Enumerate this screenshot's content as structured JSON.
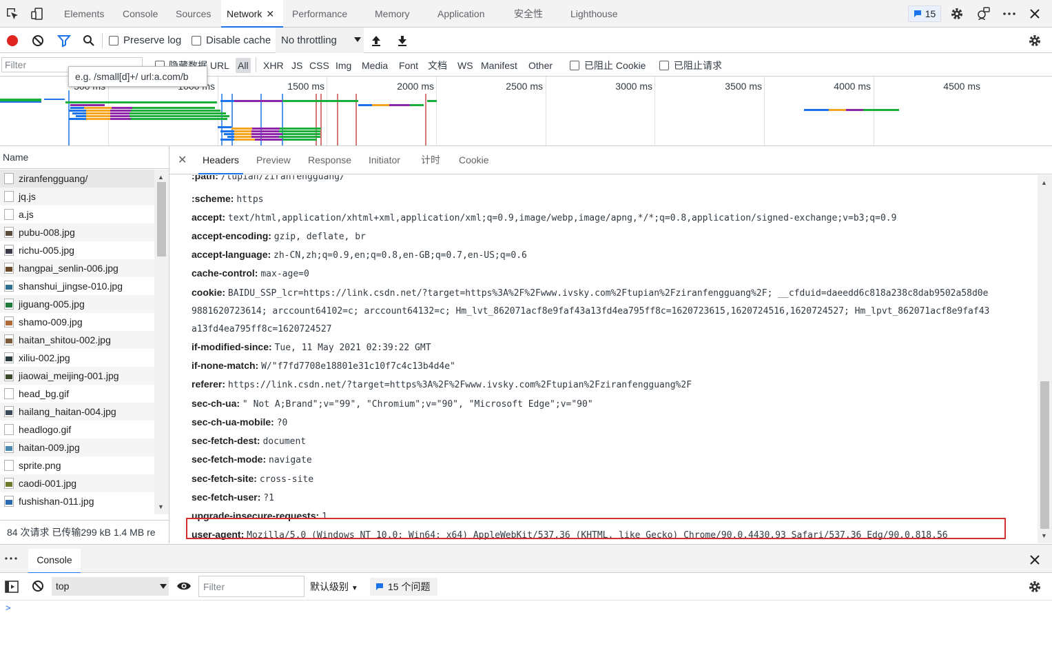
{
  "tabbar": {
    "tabs": [
      "Elements",
      "Console",
      "Sources",
      "Network",
      "Performance",
      "Memory",
      "Application",
      "安全性",
      "Lighthouse"
    ],
    "active": "Network",
    "issues_count": "15"
  },
  "toolbar": {
    "preserve_log": "Preserve log",
    "disable_cache": "Disable cache",
    "throttling": "No throttling"
  },
  "filter": {
    "placeholder": "Filter",
    "hide_data_urls": "隐藏数据 URL",
    "types": [
      "All",
      "XHR",
      "JS",
      "CSS",
      "Img",
      "Media",
      "Font",
      "文档",
      "WS",
      "Manifest",
      "Other"
    ],
    "blocked_cookies": "已阻止 Cookie",
    "blocked_requests": "已阻止请求",
    "tooltip": "e.g. /small[d]+/ url:a.com/b"
  },
  "overview": {
    "ticks": [
      "500 ms",
      "1000 ms",
      "1500 ms",
      "2000 ms",
      "2500 ms",
      "3000 ms",
      "3500 ms",
      "4000 ms",
      "4500 ms"
    ]
  },
  "requests": {
    "header": "Name",
    "files": [
      {
        "name": "ziranfengguang/",
        "kind": "doc"
      },
      {
        "name": "jq.js",
        "kind": "doc"
      },
      {
        "name": "a.js",
        "kind": "doc"
      },
      {
        "name": "pubu-008.jpg",
        "kind": "img",
        "color": "#5a4a3a"
      },
      {
        "name": "richu-005.jpg",
        "kind": "img",
        "color": "#3b3b4a"
      },
      {
        "name": "hangpai_senlin-006.jpg",
        "kind": "img",
        "color": "#6a4a2a"
      },
      {
        "name": "shanshui_jingse-010.jpg",
        "kind": "img",
        "color": "#2f6f8f"
      },
      {
        "name": "jiguang-005.jpg",
        "kind": "img",
        "color": "#1f7a3a"
      },
      {
        "name": "shamo-009.jpg",
        "kind": "img",
        "color": "#b06a3a"
      },
      {
        "name": "haitan_shitou-002.jpg",
        "kind": "img",
        "color": "#7a5a3a"
      },
      {
        "name": "xiliu-002.jpg",
        "kind": "img",
        "color": "#2a3a3a"
      },
      {
        "name": "jiaowai_meijing-001.jpg",
        "kind": "img",
        "color": "#3a4a2a"
      },
      {
        "name": "head_bg.gif",
        "kind": "doc"
      },
      {
        "name": "hailang_haitan-004.jpg",
        "kind": "img",
        "color": "#3a4a5a"
      },
      {
        "name": "headlogo.gif",
        "kind": "doc"
      },
      {
        "name": "haitan-009.jpg",
        "kind": "img",
        "color": "#4a8ab0"
      },
      {
        "name": "sprite.png",
        "kind": "doc"
      },
      {
        "name": "caodi-001.jpg",
        "kind": "img",
        "color": "#6a7a2a"
      },
      {
        "name": "fushishan-011.jpg",
        "kind": "img",
        "color": "#2a6ab0"
      }
    ],
    "status": "84 次请求  已传输299 kB  1.4 MB re"
  },
  "details": {
    "tabs": [
      "Headers",
      "Preview",
      "Response",
      "Initiator",
      "计时",
      "Cookie"
    ],
    "active_tab": "Headers",
    "headers": [
      {
        "name": ":path:",
        "value": "/tupian/ziranfengguang/",
        "partial": true
      },
      {
        "name": ":scheme:",
        "value": "https"
      },
      {
        "name": "accept:",
        "value": "text/html,application/xhtml+xml,application/xml;q=0.9,image/webp,image/apng,*/*;q=0.8,application/signed-exchange;v=b3;q=0.9"
      },
      {
        "name": "accept-encoding:",
        "value": "gzip, deflate, br"
      },
      {
        "name": "accept-language:",
        "value": "zh-CN,zh;q=0.9,en;q=0.8,en-GB;q=0.7,en-US;q=0.6"
      },
      {
        "name": "cache-control:",
        "value": "max-age=0"
      },
      {
        "name": "cookie:",
        "value": "BAIDU_SSP_lcr=https://link.csdn.net/?target=https%3A%2F%2Fwww.ivsky.com%2Ftupian%2Fziranfengguang%2F; __cfduid=daeedd6c818a238c8dab9502a58d0e",
        "cont1": "9881620723614; arccount64102=c; arccount64132=c; Hm_lvt_862071acf8e9faf43a13fd4ea795ff8c=1620723615,1620724516,1620724527; Hm_lpvt_862071acf8e9faf43",
        "cont2": "a13fd4ea795ff8c=1620724527"
      },
      {
        "name": "if-modified-since:",
        "value": "Tue, 11 May 2021 02:39:22 GMT"
      },
      {
        "name": "if-none-match:",
        "value": "W/\"f7fd7708e18801e31c10f7c4c13b4d4e\""
      },
      {
        "name": "referer:",
        "value": "https://link.csdn.net/?target=https%3A%2F%2Fwww.ivsky.com%2Ftupian%2Fziranfengguang%2F"
      },
      {
        "name": "sec-ch-ua:",
        "value": "\" Not A;Brand\";v=\"99\", \"Chromium\";v=\"90\", \"Microsoft Edge\";v=\"90\""
      },
      {
        "name": "sec-ch-ua-mobile:",
        "value": "?0"
      },
      {
        "name": "sec-fetch-dest:",
        "value": "document"
      },
      {
        "name": "sec-fetch-mode:",
        "value": "navigate"
      },
      {
        "name": "sec-fetch-site:",
        "value": "cross-site"
      },
      {
        "name": "sec-fetch-user:",
        "value": "?1"
      },
      {
        "name": "upgrade-insecure-requests:",
        "value": "1"
      },
      {
        "name": "user-agent:",
        "value": "Mozilla/5.0 (Windows NT 10.0; Win64; x64) AppleWebKit/537.36 (KHTML, like Gecko) Chrome/90.0.4430.93 Safari/537.36 Edg/90.0.818.56"
      }
    ]
  },
  "drawer": {
    "tab": "Console",
    "context": "top",
    "filter_placeholder": "Filter",
    "level": "默认级别",
    "issues": "15 个问题"
  },
  "colors": {
    "accent": "#1a73e8",
    "record_red": "#e0241f",
    "highlight_box": "#d32f2f"
  }
}
